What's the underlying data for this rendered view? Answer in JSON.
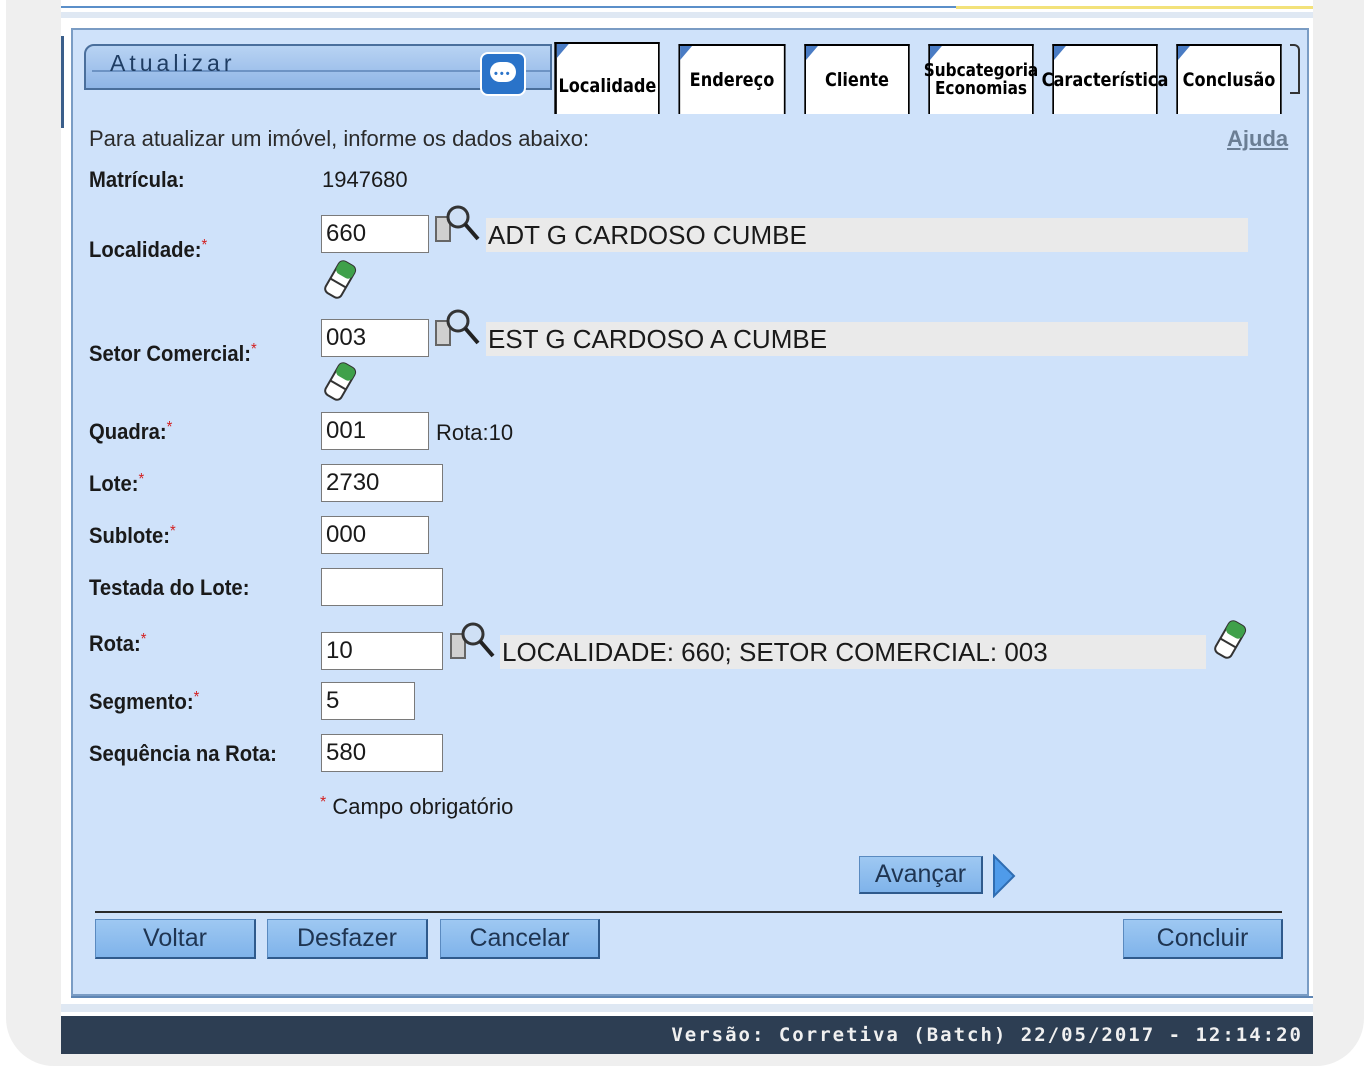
{
  "header": {
    "title": "Atualizar",
    "tabs": [
      {
        "label": "Localidade",
        "active": true
      },
      {
        "label": "Endereço"
      },
      {
        "label": "Cliente"
      },
      {
        "label_line1": "Subcategoria",
        "label_line2": "Economias"
      },
      {
        "label": "Característica"
      },
      {
        "label": "Conclusão"
      }
    ]
  },
  "intro": "Para atualizar um imóvel, informe os dados abaixo:",
  "help": "Ajuda",
  "required_mark": "*",
  "form": {
    "matricula": {
      "label": "Matrícula:",
      "value": "1947680"
    },
    "localidade": {
      "label": "Localidade:",
      "value": "660",
      "description": "ADT G CARDOSO CUMBE"
    },
    "setor": {
      "label": "Setor Comercial:",
      "value": "003",
      "description": "EST G CARDOSO A CUMBE"
    },
    "quadra": {
      "label": "Quadra:",
      "value": "001",
      "extra": "Rota:10"
    },
    "lote": {
      "label": "Lote:",
      "value": "2730"
    },
    "sublote": {
      "label": "Sublote:",
      "value": "000"
    },
    "testada": {
      "label": "Testada do Lote:",
      "value": ""
    },
    "rota": {
      "label": "Rota:",
      "value": "10",
      "description": "LOCALIDADE: 660; SETOR COMERCIAL: 003"
    },
    "segmento": {
      "label": "Segmento:",
      "value": "5"
    },
    "sequencia": {
      "label": "Sequência na Rota:",
      "value": "580"
    },
    "required_note": "Campo obrigatório"
  },
  "buttons": {
    "avancar": "Avançar",
    "voltar": "Voltar",
    "desfazer": "Desfazer",
    "cancelar": "Cancelar",
    "concluir": "Concluir"
  },
  "footer": "Versão: Corretiva (Batch) 22/05/2017 - 12:14:20",
  "colors": {
    "panel_bg": "#cfe2fa",
    "button_bg": "#8fbdec",
    "footer_bg": "#2d3e53",
    "required": "#d22020"
  },
  "icons": [
    "chat-icon",
    "search-icon",
    "eraser-icon",
    "arrow-right-icon"
  ]
}
